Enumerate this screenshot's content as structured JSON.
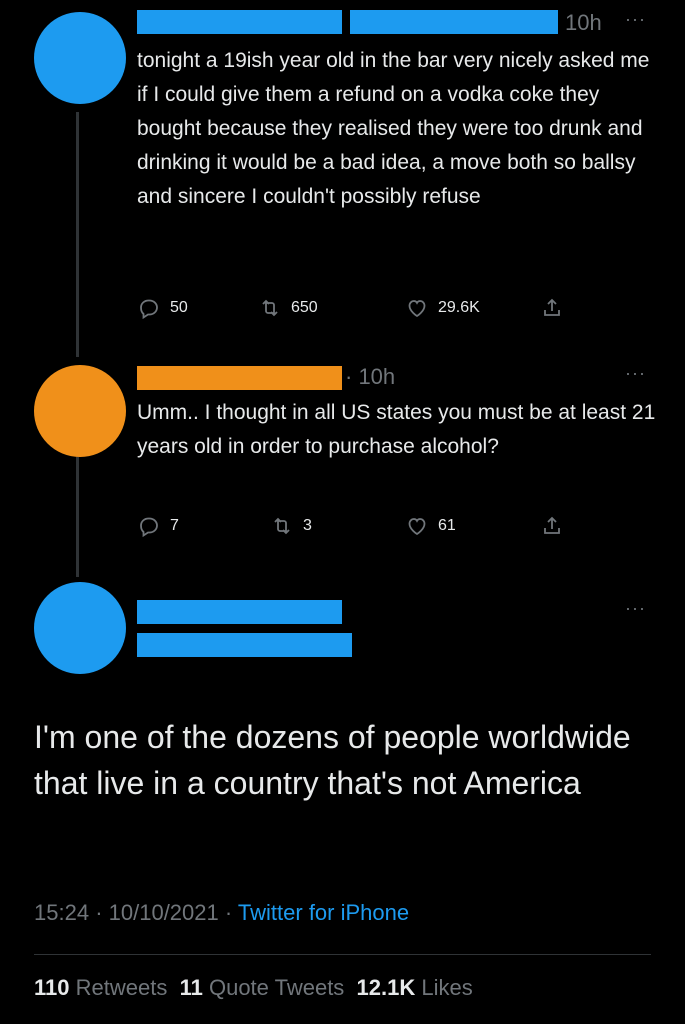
{
  "colors": {
    "blue_accent": "#1d9bf0",
    "orange_accent": "#f0901a",
    "link": "#1d9bf0",
    "muted": "#71767b",
    "text": "#e7e9ea"
  },
  "tweet1": {
    "time": "10h",
    "more_icon": "ellipsis-icon",
    "text": "tonight a 19ish year old in the bar very nicely asked me if I could give them a refund on a vodka coke they bought because they realised they were too drunk and drinking it would be a bad idea, a move both so ballsy and sincere I couldn't possibly refuse",
    "replies": "50",
    "retweets": "650",
    "likes": "29.6K"
  },
  "tweet2": {
    "time": "· 10h",
    "more_icon": "ellipsis-icon",
    "text": "Umm.. I thought in all US states you must be at least 21 years old in order to purchase alcohol?",
    "replies": "7",
    "retweets": "3",
    "likes": "61"
  },
  "main_tweet": {
    "more_icon": "ellipsis-icon",
    "text": "I'm one of the dozens of people worldwide that live in a country that's not America",
    "time": "15:24",
    "date": "10/10/2021",
    "source": "Twitter for iPhone",
    "retweets_count": "110",
    "retweets_label": "Retweets",
    "quotes_count": "11",
    "quotes_label": "Quote Tweets",
    "likes_count": "12.1K",
    "likes_label": "Likes"
  }
}
